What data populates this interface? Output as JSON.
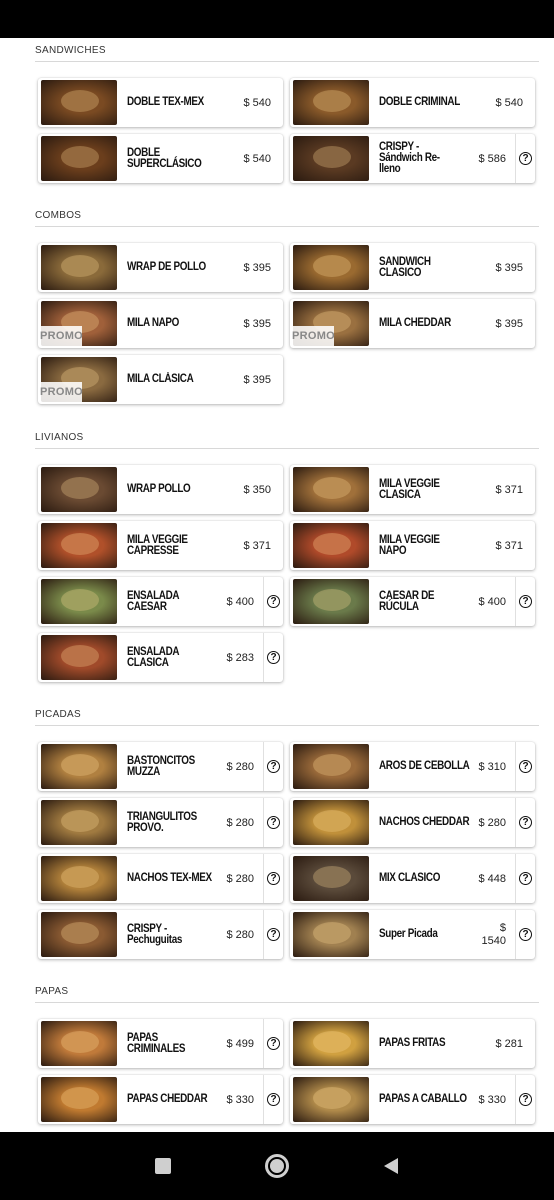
{
  "sections": [
    {
      "title": "SANDWICHES",
      "items": [
        {
          "name": "DOBLE TEX-MEX",
          "price": "$ 540",
          "info": false,
          "promo": false,
          "color": "#7a4a22"
        },
        {
          "name": "DOBLE CRIMINAL",
          "price": "$ 540",
          "info": false,
          "promo": false,
          "color": "#8a5a2a"
        },
        {
          "name": "DOBLE\nSUPERCLÁSICO",
          "price": "$ 540",
          "info": false,
          "promo": false,
          "color": "#6b3e1c"
        },
        {
          "name": "CRISPY -\nSándwich Re-\nlleno",
          "price": "$ 586",
          "info": true,
          "promo": false,
          "color": "#5a3a22"
        }
      ]
    },
    {
      "title": "COMBOS",
      "items": [
        {
          "name": "WRAP DE POLLO",
          "price": "$ 395",
          "info": false,
          "promo": false,
          "color": "#8a6a3a"
        },
        {
          "name": "SANDWICH\nCLASICO",
          "price": "$ 395",
          "info": false,
          "promo": false,
          "color": "#9a6a30"
        },
        {
          "name": "MILA NAPO",
          "price": "$ 395",
          "info": false,
          "promo": true,
          "color": "#a0603a"
        },
        {
          "name": "MILA CHEDDAR",
          "price": "$ 395",
          "info": false,
          "promo": true,
          "color": "#9a7040"
        },
        {
          "name": "MILA CLÁSICA",
          "price": "$ 395",
          "info": false,
          "promo": true,
          "color": "#8a6a40"
        }
      ]
    },
    {
      "title": "LIVIANOS",
      "items": [
        {
          "name": "WRAP POLLO",
          "price": "$ 350",
          "info": false,
          "promo": false,
          "color": "#6a4a32"
        },
        {
          "name": "MILA VEGGIE\nCLASICA",
          "price": "$ 371",
          "info": false,
          "promo": false,
          "color": "#a0703a"
        },
        {
          "name": "MILA VEGGIE\nCAPRESSE",
          "price": "$ 371",
          "info": false,
          "promo": false,
          "color": "#b0502a"
        },
        {
          "name": "MILA VEGGIE\nNAPO",
          "price": "$ 371",
          "info": false,
          "promo": false,
          "color": "#b04a2a"
        },
        {
          "name": "ENSALADA\nCAESAR",
          "price": "$ 400",
          "info": true,
          "promo": false,
          "color": "#7a8a4a"
        },
        {
          "name": "CAESAR DE\nRÚCULA",
          "price": "$ 400",
          "info": true,
          "promo": false,
          "color": "#6a7a4a"
        },
        {
          "name": "ENSALADA\nCLASICA",
          "price": "$ 283",
          "info": true,
          "promo": false,
          "color": "#a04a2a"
        }
      ]
    },
    {
      "title": "PICADAS",
      "items": [
        {
          "name": "BASTONCITOS\nMUZZA",
          "price": "$ 280",
          "info": true,
          "promo": false,
          "color": "#b08040"
        },
        {
          "name": "AROS DE CEBOLLA",
          "price": "$ 310",
          "info": true,
          "promo": false,
          "color": "#9a6a3a"
        },
        {
          "name": "TRIANGULITOS\nPROVO.",
          "price": "$ 280",
          "info": true,
          "promo": false,
          "color": "#a07a40"
        },
        {
          "name": "NACHOS CHEDDAR",
          "price": "$ 280",
          "info": true,
          "promo": false,
          "color": "#c0903a"
        },
        {
          "name": "NACHOS TEX-MEX",
          "price": "$ 280",
          "info": true,
          "promo": false,
          "color": "#b0803a"
        },
        {
          "name": "MIX CLASICO",
          "price": "$ 448",
          "info": true,
          "promo": false,
          "color": "#5a4a3a"
        },
        {
          "name": "CRISPY -\nPechuguitas",
          "price": "$ 280",
          "info": true,
          "promo": false,
          "color": "#8a5a32"
        },
        {
          "name": "Super Picada",
          "price": "$\n1540",
          "info": true,
          "promo": false,
          "color": "#a08050"
        }
      ]
    },
    {
      "title": "PAPAS",
      "items": [
        {
          "name": "PAPAS\nCRIMINALES",
          "price": "$ 499",
          "info": true,
          "promo": false,
          "color": "#c07a3a"
        },
        {
          "name": "PAPAS FRITAS",
          "price": "$ 281",
          "info": false,
          "promo": false,
          "color": "#d0a040"
        },
        {
          "name": "PAPAS CHEDDAR",
          "price": "$ 330",
          "info": true,
          "promo": false,
          "color": "#c07a30"
        },
        {
          "name": "PAPAS A CABALLO",
          "price": "$ 330",
          "info": true,
          "promo": false,
          "color": "#b08a4a"
        }
      ]
    }
  ],
  "promo_label": "PROMO",
  "info_glyph": "?",
  "nav": {
    "recents": "square-icon",
    "home": "circle-icon",
    "back": "triangle-icon"
  }
}
